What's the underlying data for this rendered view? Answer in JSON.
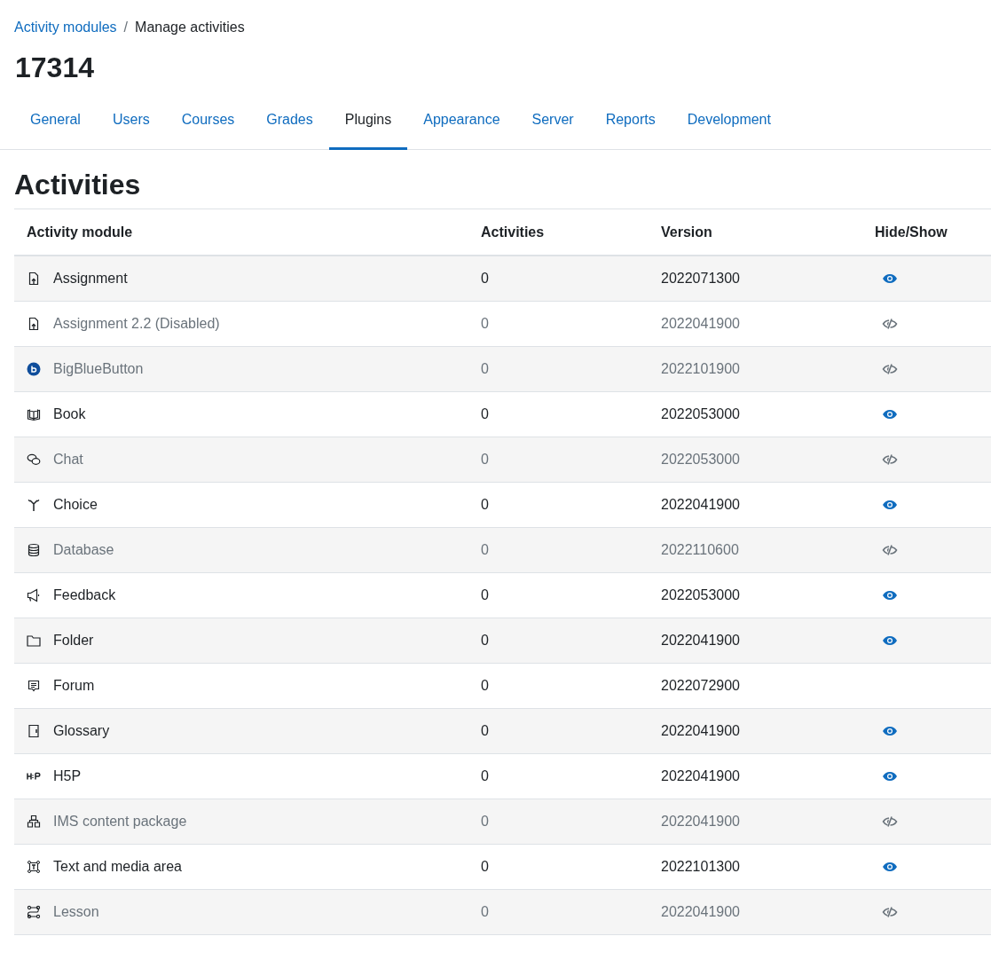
{
  "breadcrumb": {
    "separator": "/",
    "items": [
      {
        "label": "Activity modules",
        "link": true
      },
      {
        "label": "Manage activities",
        "link": false
      }
    ]
  },
  "page_title": "17314",
  "tabs": [
    {
      "label": "General",
      "selected": false
    },
    {
      "label": "Users",
      "selected": false
    },
    {
      "label": "Courses",
      "selected": false
    },
    {
      "label": "Grades",
      "selected": false
    },
    {
      "label": "Plugins",
      "selected": true
    },
    {
      "label": "Appearance",
      "selected": false
    },
    {
      "label": "Server",
      "selected": false
    },
    {
      "label": "Reports",
      "selected": false
    },
    {
      "label": "Development",
      "selected": false
    }
  ],
  "section_title": "Activities",
  "table": {
    "columns": [
      "Activity module",
      "Activities",
      "Version",
      "Hide/Show"
    ],
    "rows": [
      {
        "kind": "assignment",
        "name": "Assignment",
        "activities": "0",
        "version": "2022071300",
        "disabled": false,
        "visible": true
      },
      {
        "kind": "assignment",
        "name": "Assignment 2.2 (Disabled)",
        "activities": "0",
        "version": "2022041900",
        "disabled": true,
        "visible": false
      },
      {
        "kind": "bigbluebutton",
        "name": "BigBlueButton",
        "activities": "0",
        "version": "2022101900",
        "disabled": true,
        "visible": false
      },
      {
        "kind": "book",
        "name": "Book",
        "activities": "0",
        "version": "2022053000",
        "disabled": false,
        "visible": true
      },
      {
        "kind": "chat",
        "name": "Chat",
        "activities": "0",
        "version": "2022053000",
        "disabled": true,
        "visible": false
      },
      {
        "kind": "choice",
        "name": "Choice",
        "activities": "0",
        "version": "2022041900",
        "disabled": false,
        "visible": true
      },
      {
        "kind": "database",
        "name": "Database",
        "activities": "0",
        "version": "2022110600",
        "disabled": true,
        "visible": false
      },
      {
        "kind": "feedback",
        "name": "Feedback",
        "activities": "0",
        "version": "2022053000",
        "disabled": false,
        "visible": true
      },
      {
        "kind": "folder",
        "name": "Folder",
        "activities": "0",
        "version": "2022041900",
        "disabled": false,
        "visible": true
      },
      {
        "kind": "forum",
        "name": "Forum",
        "activities": "0",
        "version": "2022072900",
        "disabled": false
      },
      {
        "kind": "glossary",
        "name": "Glossary",
        "activities": "0",
        "version": "2022041900",
        "disabled": false,
        "visible": true
      },
      {
        "kind": "h5p",
        "name": "H5P",
        "activities": "0",
        "version": "2022041900",
        "disabled": false,
        "visible": true
      },
      {
        "kind": "ims",
        "name": "IMS content package",
        "activities": "0",
        "version": "2022041900",
        "disabled": true,
        "visible": false
      },
      {
        "kind": "textmedia",
        "name": "Text and media area",
        "activities": "0",
        "version": "2022101300",
        "disabled": false,
        "visible": true
      },
      {
        "kind": "lesson",
        "name": "Lesson",
        "activities": "0",
        "version": "2022041900",
        "disabled": true,
        "visible": false
      }
    ]
  }
}
